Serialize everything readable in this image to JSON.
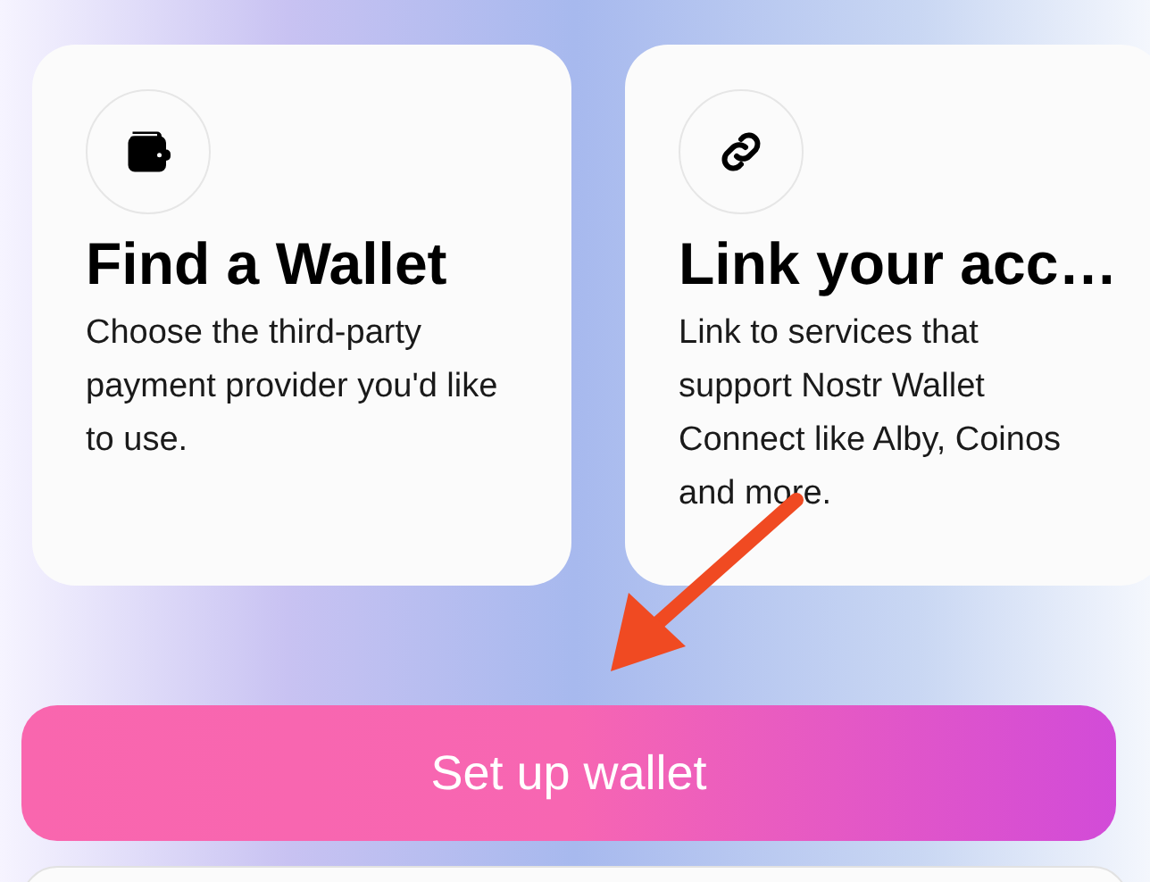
{
  "cards": [
    {
      "kind": "wallet",
      "title": "Find a Wallet",
      "text": "Choose the third-party payment provider you'd like to use."
    },
    {
      "kind": "link",
      "title": "Link your acc…",
      "text": "Link to services that support Nostr Wallet Connect like Alby, Coinos and more."
    }
  ],
  "primary_button": {
    "label": "Set up wallet"
  }
}
